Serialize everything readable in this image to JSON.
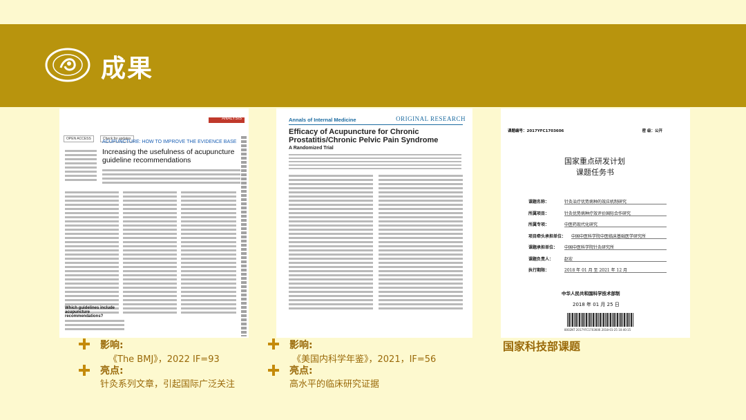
{
  "header": {
    "title": "成果"
  },
  "doc1": {
    "badge_open": "OPEN ACCESS",
    "badge_check": "Check for updates",
    "analysis_tag": "ANALYSIS",
    "section": "ACUPUNCTURE: HOW TO IMPROVE THE EVIDENCE BASE",
    "headline": "Increasing the usefulness of acupuncture guideline recommendations",
    "subheading": "Which guidelines include acupuncture recommendations?"
  },
  "doc2": {
    "journal": "Annals of Internal Medicine",
    "kind": "ORIGINAL RESEARCH",
    "headline": "Efficacy of Acupuncture for Chronic Prostatitis/Chronic Pelvic Pain Syndrome",
    "subtitle": "A Randomized Trial"
  },
  "doc3": {
    "code": "课题编号：2017YFC1703606",
    "secret": "密 级：公开",
    "title1": "国家重点研发计划",
    "title2": "课题任务书",
    "rows": [
      {
        "k": "课题名称：",
        "v": "针灸治疗优势病种的效应机制研究"
      },
      {
        "k": "所属项目：",
        "v": "针灸优势病种疗效评价国际合作研究"
      },
      {
        "k": "所属专项：",
        "v": "中医药现代化研究"
      },
      {
        "k": "项目牵头承担单位：",
        "v": "中国中医科学院中医临床基础医学研究所"
      },
      {
        "k": "课题承担单位：",
        "v": "中国中医科学院针灸研究所"
      },
      {
        "k": "课题负责人：",
        "v": "赵宏"
      },
      {
        "k": "执行期限：",
        "v": "2018 年 01 月 至 2021 年 12 月"
      }
    ],
    "org": "中华人民共和国科学技术部制",
    "date": "2018 年 01 月 25 日",
    "barcode_text": "8002NT 2017YFC1703606 2018-01-25 10:40:15"
  },
  "captions": {
    "left": {
      "impact_label": "影响:",
      "impact_value": "《The BMJ》，2022 IF=93",
      "highlight_label": "亮点:",
      "highlight_value": "针灸系列文章，引起国际广泛关注"
    },
    "middle": {
      "impact_label": "影响:",
      "impact_value": "《美国内科学年鉴》，2021，IF=56",
      "highlight_label": "亮点:",
      "highlight_value": "高水平的临床研究证据"
    },
    "right": {
      "project_label": "国家科技部课题"
    }
  }
}
